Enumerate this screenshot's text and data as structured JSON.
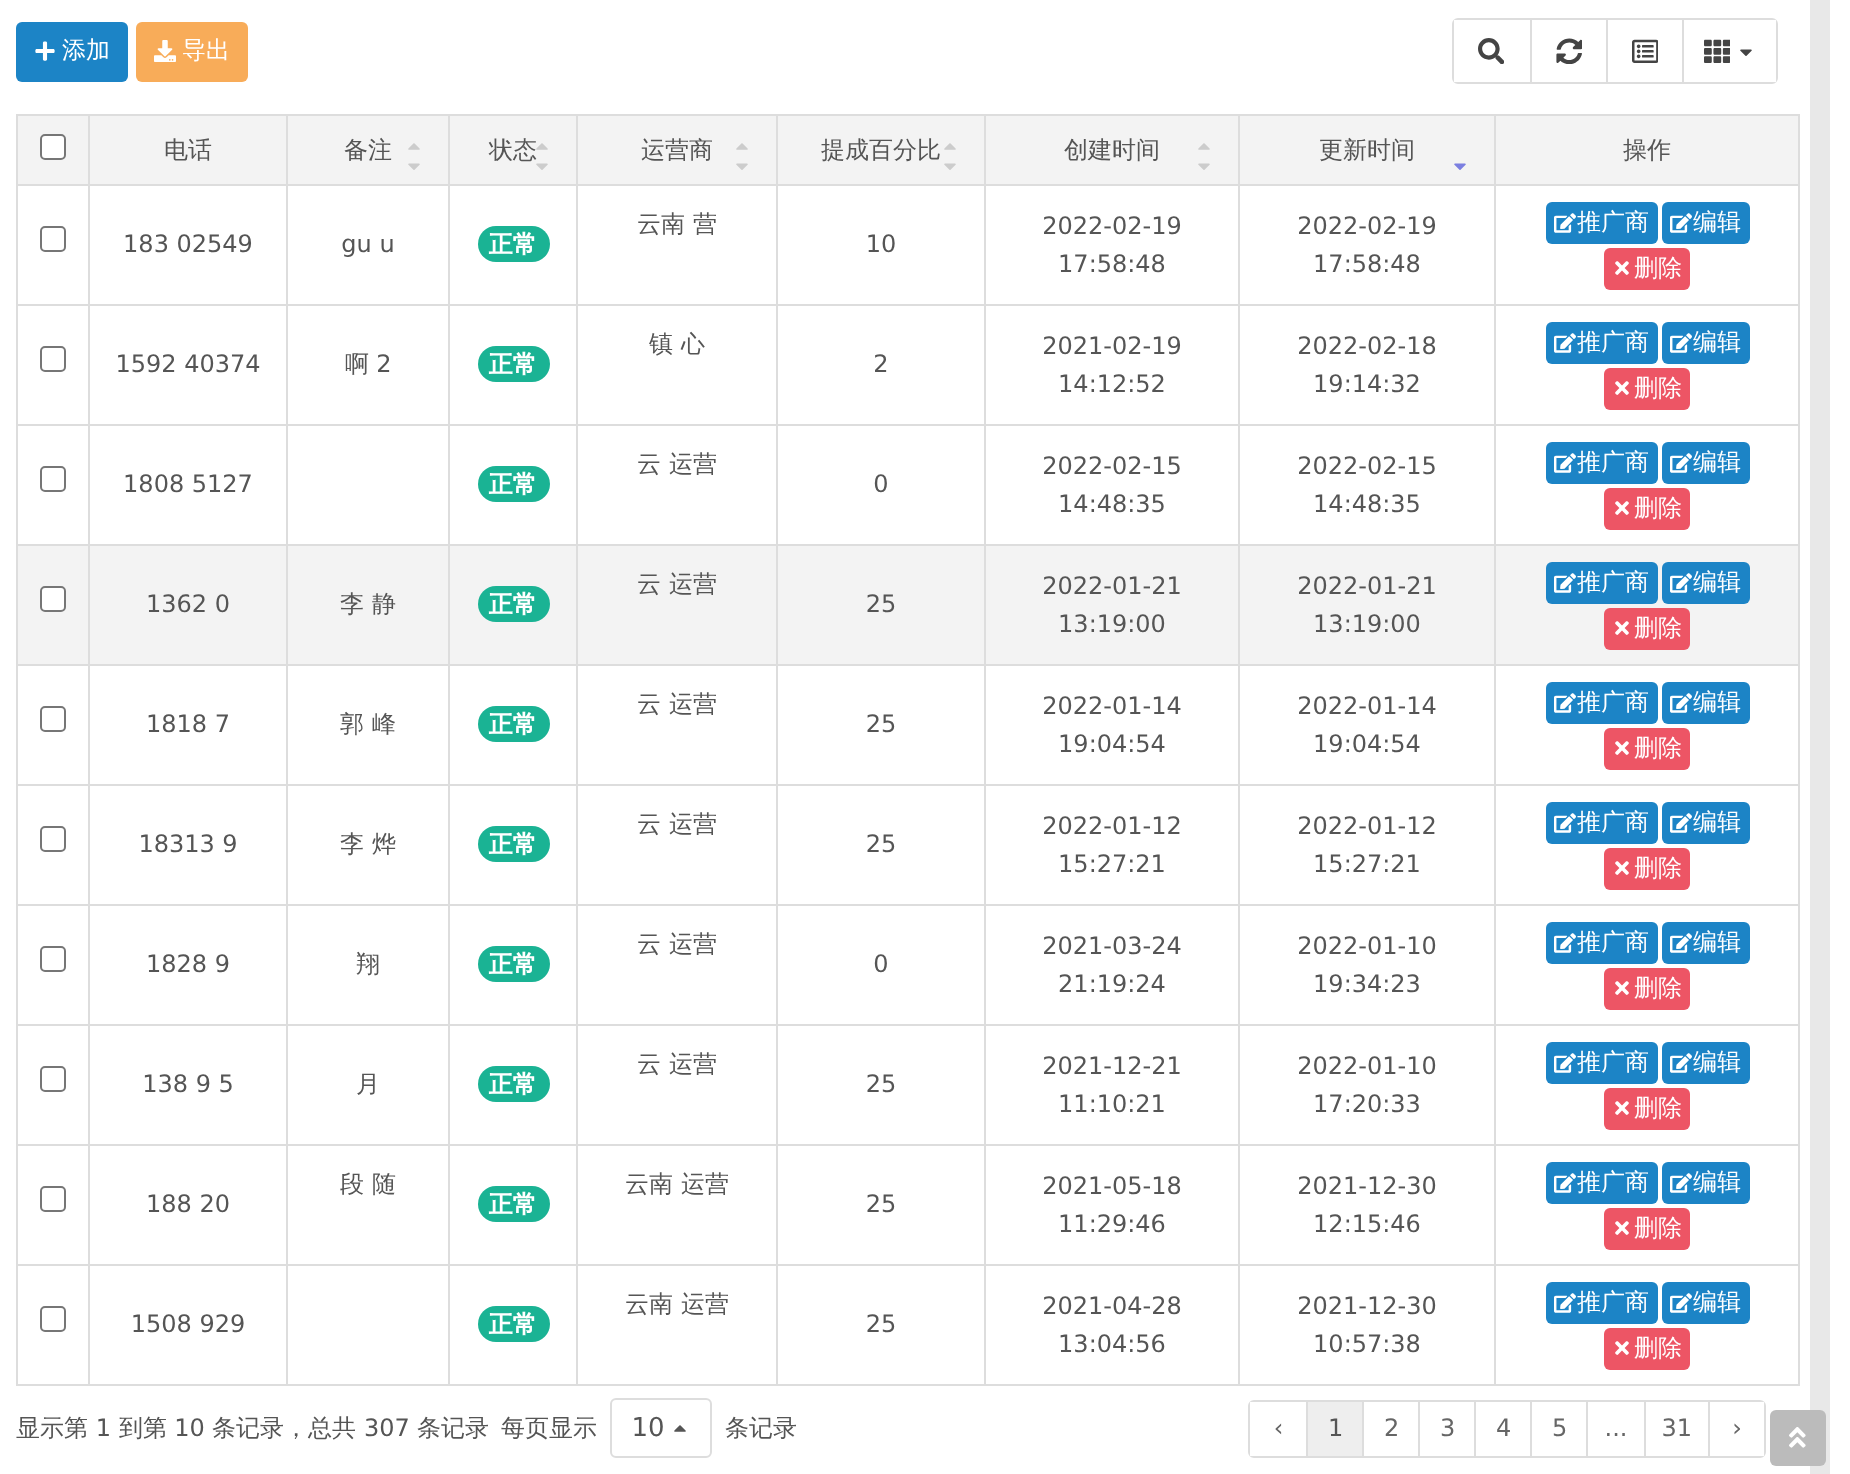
{
  "toolbar": {
    "left_buttons": [
      {
        "label": "添加",
        "kind": "add"
      },
      {
        "label": "导出",
        "kind": "export"
      }
    ],
    "right_buttons": [
      {
        "kind": "search"
      },
      {
        "kind": "refresh"
      },
      {
        "kind": "list"
      },
      {
        "kind": "columns"
      }
    ]
  },
  "table": {
    "all_checked": false,
    "columns": [
      {
        "label": "电话"
      },
      {
        "label": "备注",
        "sortable": true,
        "sorted_desc": false
      },
      {
        "label": "状态",
        "sortable": true,
        "sorted_desc": false
      },
      {
        "label": "运营商",
        "sortable": true,
        "sorted_desc": false
      },
      {
        "label": "提成百分比",
        "sortable": true,
        "sorted_desc": false
      },
      {
        "label": "创建时间",
        "sortable": true,
        "sorted_desc": false
      },
      {
        "label": "更新时间",
        "sortable": true,
        "sorted_desc": true
      },
      {
        "label": "操作"
      }
    ],
    "rows": [
      {
        "checked": false,
        "highlighted": false,
        "phone": "183 02549",
        "remark": "gu u",
        "status": "正常",
        "operator": "云南 营",
        "percent": "10",
        "created": [
          "2022-02-19",
          "17:58:48"
        ],
        "updated": [
          "2022-02-19",
          "17:58:48"
        ],
        "actions": [
          "推广商",
          "编辑",
          "删除"
        ]
      },
      {
        "checked": false,
        "highlighted": false,
        "phone": "1592 40374",
        "remark": "啊 2",
        "status": "正常",
        "operator": "镇 心",
        "percent": "2",
        "created": [
          "2021-02-19",
          "14:12:52"
        ],
        "updated": [
          "2022-02-18",
          "19:14:32"
        ],
        "actions": [
          "推广商",
          "编辑",
          "删除"
        ]
      },
      {
        "checked": false,
        "highlighted": false,
        "phone": "1808 5127",
        "remark": "",
        "status": "正常",
        "operator": "云 运营",
        "percent": "0",
        "created": [
          "2022-02-15",
          "14:48:35"
        ],
        "updated": [
          "2022-02-15",
          "14:48:35"
        ],
        "actions": [
          "推广商",
          "编辑",
          "删除"
        ]
      },
      {
        "checked": false,
        "highlighted": true,
        "phone": "1362 0",
        "remark": "李 静",
        "status": "正常",
        "operator": "云 运营",
        "percent": "25",
        "created": [
          "2022-01-21",
          "13:19:00"
        ],
        "updated": [
          "2022-01-21",
          "13:19:00"
        ],
        "actions": [
          "推广商",
          "编辑",
          "删除"
        ]
      },
      {
        "checked": false,
        "highlighted": false,
        "phone": "1818 7",
        "remark": "郭 峰",
        "status": "正常",
        "operator": "云 运营",
        "percent": "25",
        "created": [
          "2022-01-14",
          "19:04:54"
        ],
        "updated": [
          "2022-01-14",
          "19:04:54"
        ],
        "actions": [
          "推广商",
          "编辑",
          "删除"
        ]
      },
      {
        "checked": false,
        "highlighted": false,
        "phone": "18313 9",
        "remark": "李 烨",
        "status": "正常",
        "operator": "云 运营",
        "percent": "25",
        "created": [
          "2022-01-12",
          "15:27:21"
        ],
        "updated": [
          "2022-01-12",
          "15:27:21"
        ],
        "actions": [
          "推广商",
          "编辑",
          "删除"
        ]
      },
      {
        "checked": false,
        "highlighted": false,
        "phone": "1828 9",
        "remark": "翔",
        "status": "正常",
        "operator": "云 运营",
        "percent": "0",
        "created": [
          "2021-03-24",
          "21:19:24"
        ],
        "updated": [
          "2022-01-10",
          "19:34:23"
        ],
        "actions": [
          "推广商",
          "编辑",
          "删除"
        ]
      },
      {
        "checked": false,
        "highlighted": false,
        "phone": "138 9 5",
        "remark": "月",
        "status": "正常",
        "operator": "云 运营",
        "percent": "25",
        "created": [
          "2021-12-21",
          "11:10:21"
        ],
        "updated": [
          "2022-01-10",
          "17:20:33"
        ],
        "actions": [
          "推广商",
          "编辑",
          "删除"
        ]
      },
      {
        "checked": false,
        "highlighted": false,
        "phone": "188 20",
        "remark": "段 随",
        "status": "正常",
        "operator": "云南 运营",
        "percent": "25",
        "created": [
          "2021-05-18",
          "11:29:46"
        ],
        "updated": [
          "2021-12-30",
          "12:15:46"
        ],
        "actions": [
          "推广商",
          "编辑",
          "删除"
        ]
      },
      {
        "checked": false,
        "highlighted": false,
        "phone": "1508 929",
        "remark": "",
        "status": "正常",
        "operator": "云南 运营",
        "percent": "25",
        "created": [
          "2021-04-28",
          "13:04:56"
        ],
        "updated": [
          "2021-12-30",
          "10:57:38"
        ],
        "actions": [
          "推广商",
          "编辑",
          "删除"
        ]
      }
    ]
  },
  "footer": {
    "summary": "显示第 1 到第 10 条记录，总共 307 条记录",
    "per_page_label": "每页显示",
    "per_page": "10",
    "per_page_suffix": "条记录",
    "pages": [
      {
        "label": "‹",
        "selected": false
      },
      {
        "label": "1",
        "selected": true
      },
      {
        "label": "2",
        "selected": false
      },
      {
        "label": "3",
        "selected": false
      },
      {
        "label": "4",
        "selected": false
      },
      {
        "label": "5",
        "selected": false
      },
      {
        "label": "...",
        "selected": false
      },
      {
        "label": "31",
        "selected": false
      },
      {
        "label": "›",
        "selected": false
      }
    ]
  }
}
